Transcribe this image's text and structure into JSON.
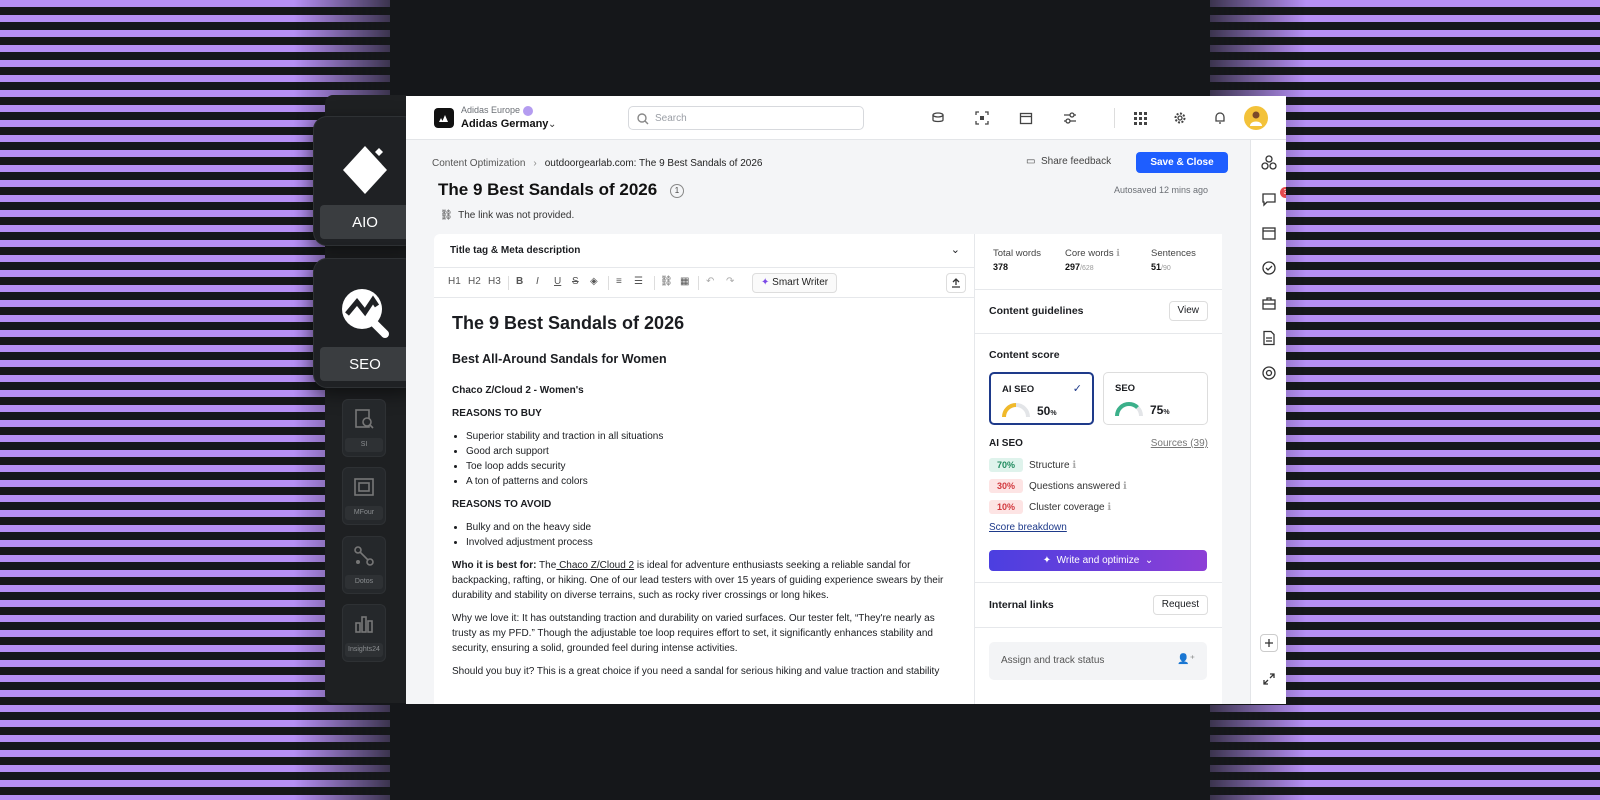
{
  "dock": {
    "aio_label": "AIO",
    "seo_label": "SEO",
    "apps": [
      {
        "label": "SI"
      },
      {
        "label": "MFour"
      },
      {
        "label": "Dotos"
      },
      {
        "label": "Insights24"
      }
    ]
  },
  "topbar": {
    "org_parent": "Adidas Europe",
    "org_name": "Adidas Germany",
    "search_placeholder": "Search"
  },
  "header": {
    "breadcrumb_root": "Content Optimization",
    "breadcrumb_current": "outdoorgearlab.com: The 9 Best Sandals of 2026",
    "share_label": "Share feedback",
    "save_label": "Save & Close",
    "autosave": "Autosaved 12 mins ago",
    "title": "The 9 Best Sandals of 2026",
    "title_badge": "1",
    "link_note": "The link was not provided."
  },
  "editor": {
    "meta_label": "Title tag & Meta description",
    "toolbar": {
      "h1": "H1",
      "h2": "H2",
      "h3": "H3",
      "smart_writer": "Smart Writer"
    },
    "h1": "The 9 Best Sandals of 2026",
    "h2": "Best All-Around Sandals for Women",
    "h3": "Chaco Z/Cloud 2 - Women's",
    "buy_heading": "REASONS TO BUY",
    "buy_items": [
      "Superior stability and traction in all situations",
      "Good arch support",
      "Toe loop adds security",
      "A ton of patterns and colors"
    ],
    "avoid_heading": "REASONS TO AVOID",
    "avoid_items": [
      "Bulky and on the heavy side",
      "Involved adjustment process"
    ],
    "p1_bold": "Who it is best for:",
    "p1_pre": " The",
    "p1_link": " Chaco Z/Cloud 2",
    "p1_post": " is ideal for adventure enthusiasts seeking a reliable sandal for backpacking, rafting, or hiking. One of our lead testers with over 15 years of guiding experience swears by their durability and stability on diverse terrains, such as rocky river crossings or long hikes.",
    "p2": "Why we love it: It has outstanding traction and durability on varied surfaces. Our tester felt, “They're nearly as trusty as my PFD.” Though the adjustable toe loop requires effort to set, it significantly enhances stability and security, ensuring a solid, grounded feel during intense activities.",
    "p3": "Should you buy it? This is a great choice if you need a sandal for serious hiking and value traction and stability"
  },
  "panel": {
    "stats": [
      {
        "label": "Total words",
        "value": "378",
        "max": ""
      },
      {
        "label": "Core words",
        "value": "297",
        "max": "/628"
      },
      {
        "label": "Sentences",
        "value": "51",
        "max": "/90"
      }
    ],
    "guidelines_label": "Content guidelines",
    "view_label": "View",
    "score_label": "Content score",
    "scores": [
      {
        "name": "AI SEO",
        "value": "50",
        "unit": "%",
        "fraction": 0.5,
        "color": "#f0b92b"
      },
      {
        "name": "SEO",
        "value": "75",
        "unit": "%",
        "fraction": 0.75,
        "color": "#3bb08a"
      }
    ],
    "aiseo_label": "AI SEO",
    "sources_label": "Sources (39)",
    "metrics": [
      {
        "pct": "70%",
        "label": "Structure",
        "bg": "#dff3ec",
        "fg": "#1f8a5e"
      },
      {
        "pct": "30%",
        "label": "Questions answered",
        "bg": "#fde4e4",
        "fg": "#d2393e"
      },
      {
        "pct": "10%",
        "label": "Cluster coverage",
        "bg": "#fde4e4",
        "fg": "#d2393e"
      }
    ],
    "breakdown_label": "Score breakdown",
    "write_label": "Write and optimize",
    "internal_links_label": "Internal links",
    "request_label": "Request",
    "assign_label": "Assign and track status"
  },
  "rail": {
    "chat_badge": "3"
  }
}
